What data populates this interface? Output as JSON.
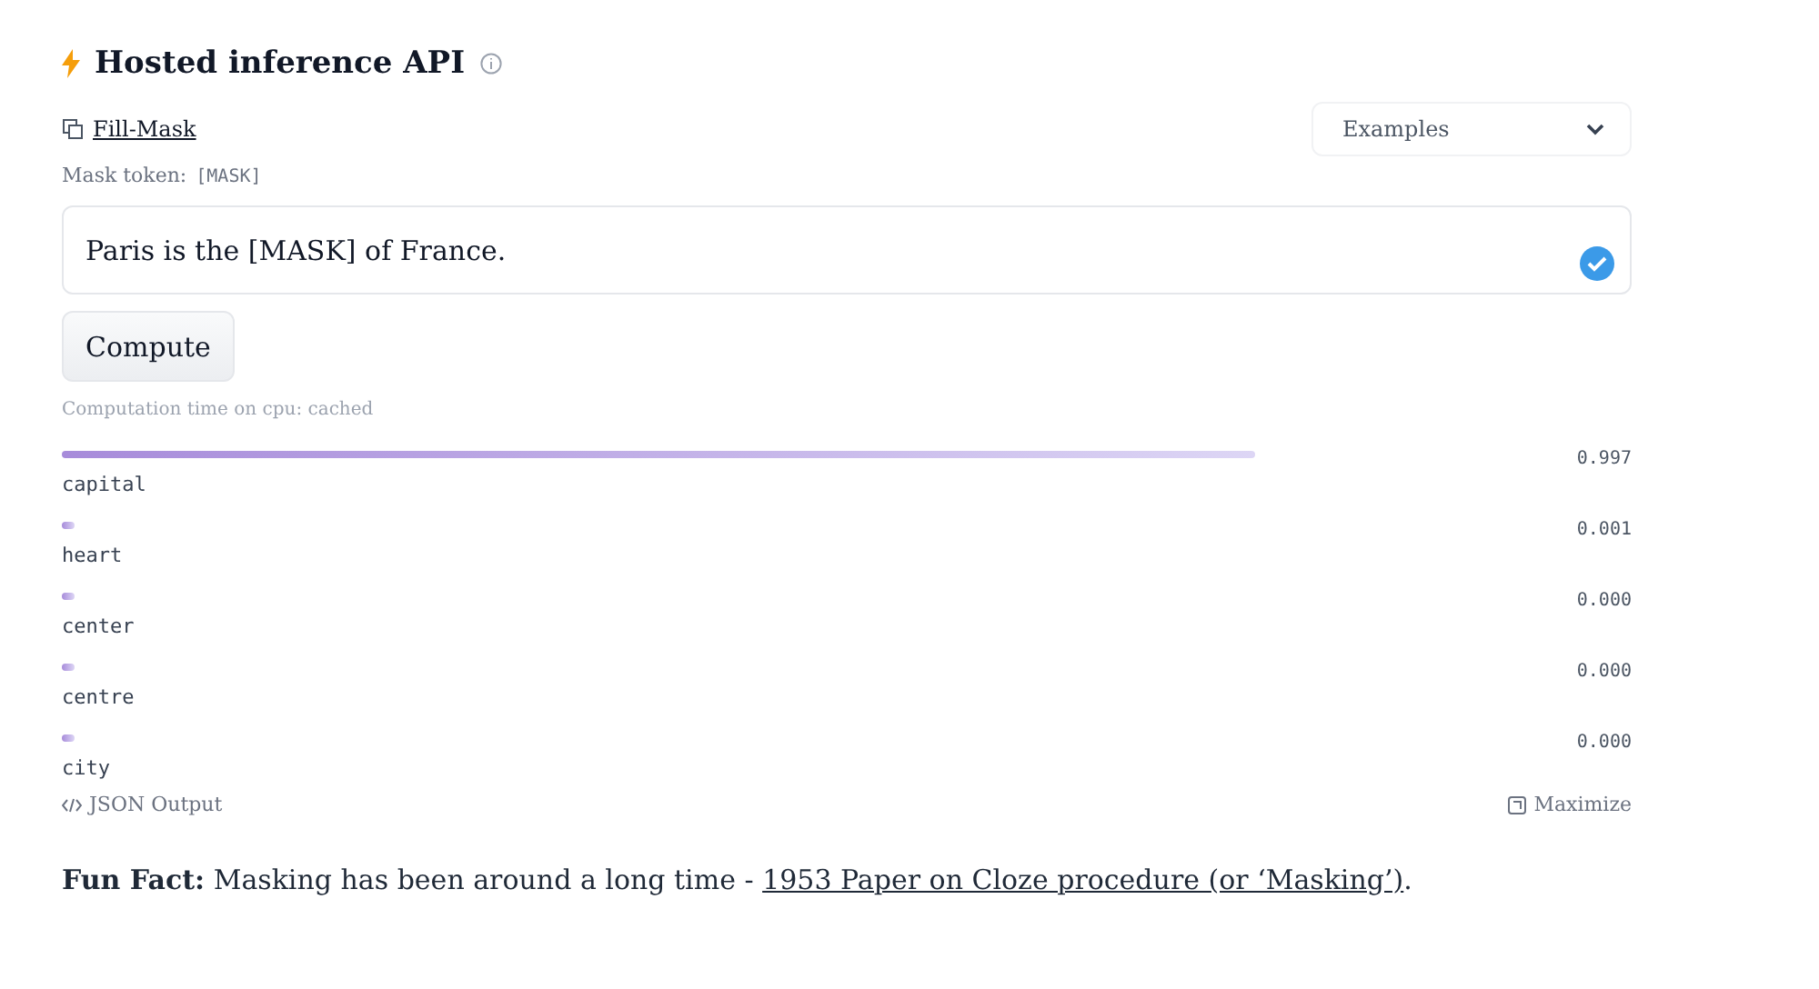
{
  "header": {
    "title": "Hosted inference API"
  },
  "task": {
    "label": "Fill-Mask"
  },
  "examples_dropdown": {
    "value": "Examples"
  },
  "mask_token": {
    "label": "Mask token:",
    "token": "[MASK]"
  },
  "input": {
    "value": "Paris is the [MASK] of France.",
    "valid": true
  },
  "compute_button": {
    "label": "Compute"
  },
  "computation_time": "Computation time on cpu: cached",
  "results": [
    {
      "label": "capital",
      "score": "0.997"
    },
    {
      "label": "heart",
      "score": "0.001"
    },
    {
      "label": "center",
      "score": "0.000"
    },
    {
      "label": "centre",
      "score": "0.000"
    },
    {
      "label": "city",
      "score": "0.000"
    }
  ],
  "footer": {
    "json_output": "JSON Output",
    "maximize": "Maximize"
  },
  "fun_fact": {
    "text": "**Fun Fact:** Masking has been around a long time - ",
    "link": "1953 Paper on Cloze procedure (or ‘Masking’)",
    "end": "."
  }
}
